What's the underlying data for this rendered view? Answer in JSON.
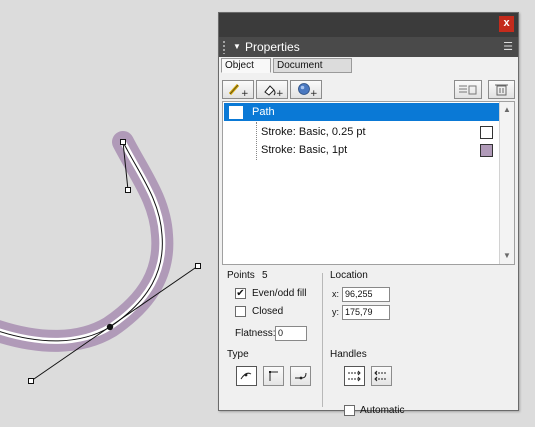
{
  "panel": {
    "title": "Properties",
    "close_label": "x",
    "menu_icon": "panel-menu-icon",
    "tabs": [
      {
        "label": "Object",
        "active": true
      },
      {
        "label": "Document",
        "active": false
      }
    ]
  },
  "toolbar": {
    "icons": [
      "pencil-add-icon",
      "fill-add-icon",
      "effect-add-icon",
      "list-delete-icon",
      "trash-icon"
    ]
  },
  "tree": {
    "items": [
      {
        "label": "Path",
        "selected": true
      },
      {
        "label": "Stroke: Basic, 0.25 pt",
        "swatch": "#ffffff"
      },
      {
        "label": "Stroke: Basic, 1pt",
        "swatch": "#b09ab8"
      }
    ]
  },
  "points": {
    "label": "Points",
    "value": "5"
  },
  "fill_rule": {
    "label": "Even/odd fill",
    "checked": true
  },
  "closed": {
    "label": "Closed",
    "checked": false
  },
  "flatness": {
    "label": "Flatness:",
    "value": "0"
  },
  "location": {
    "label": "Location",
    "x_label": "x:",
    "x_value": "96,255",
    "y_label": "y:",
    "y_value": "175,79"
  },
  "type": {
    "label": "Type"
  },
  "handles": {
    "label": "Handles"
  },
  "automatic": {
    "label": "Automatic",
    "checked": false
  },
  "colors": {
    "stroke_outer": "#b09ab8",
    "selection": "#0a79d6",
    "close": "#c42b1c"
  }
}
